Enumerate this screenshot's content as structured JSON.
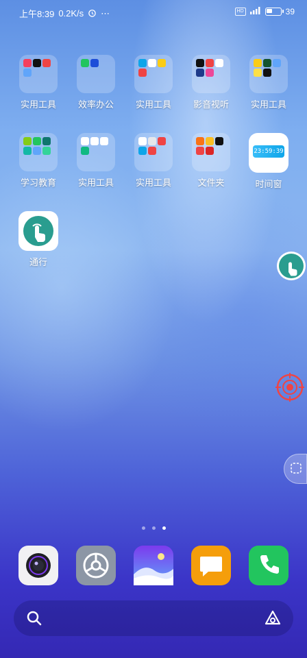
{
  "status_bar": {
    "time": "上午8:39",
    "speed": "0.2K/s",
    "hd_label": "HD",
    "network_label": "4G",
    "battery_text": "39",
    "battery_level": 0.39
  },
  "apps_row1": [
    {
      "label": "实用工具"
    },
    {
      "label": "效率办公"
    },
    {
      "label": "实用工具"
    },
    {
      "label": "影音视听"
    },
    {
      "label": "实用工具"
    }
  ],
  "apps_row2": [
    {
      "label": "学习教育"
    },
    {
      "label": "实用工具"
    },
    {
      "label": "实用工具"
    },
    {
      "label": "文件夹"
    },
    {
      "label": "时间窗"
    }
  ],
  "apps_row3": [
    {
      "label": "通行"
    }
  ],
  "time_widget_text": "23:59:39",
  "page_indicator": {
    "total": 3,
    "active": 2
  },
  "dock": [
    {
      "name": "camera"
    },
    {
      "name": "settings"
    },
    {
      "name": "gallery"
    },
    {
      "name": "notes"
    },
    {
      "name": "phone"
    }
  ],
  "colors": {
    "teal": "#2a9d8f",
    "phone_green": "#22c55e",
    "notes_orange": "#f59e0b"
  }
}
